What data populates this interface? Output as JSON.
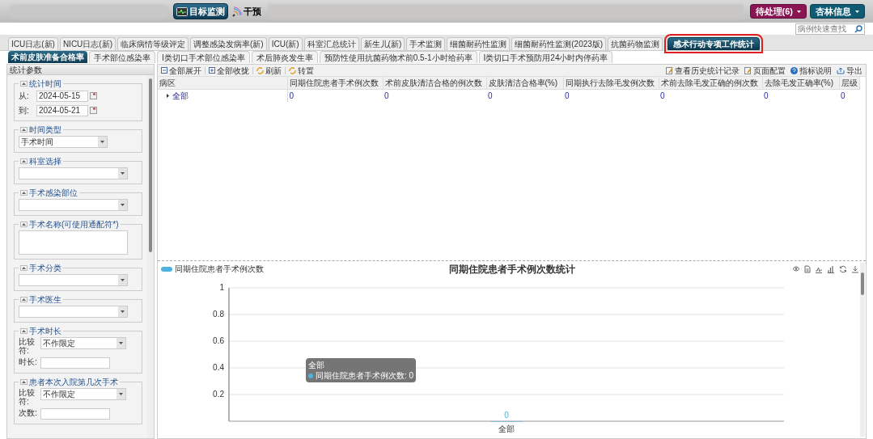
{
  "top_bar": {
    "buttons": [
      {
        "label": "目标监测",
        "kind": "monitor"
      },
      {
        "label": "干预",
        "kind": "intervene"
      }
    ],
    "right_buttons": [
      {
        "label": "待处理(6)",
        "color": "#8a1552"
      },
      {
        "label": "杏林信息",
        "color": "#0f5b74"
      }
    ]
  },
  "search": {
    "placeholder": "病例快速查找"
  },
  "tabs": [
    {
      "label": "ICU日志(新)",
      "selected": false
    },
    {
      "label": "NICU日志(新)",
      "selected": false
    },
    {
      "label": "临床病情等级评定",
      "selected": false
    },
    {
      "label": "调整感染发病率(新)",
      "selected": false
    },
    {
      "label": "ICU(新)",
      "selected": false
    },
    {
      "label": "科室汇总统计",
      "selected": false
    },
    {
      "label": "新生儿(新)",
      "selected": false
    },
    {
      "label": "手术监测",
      "selected": false
    },
    {
      "label": "细菌耐药性监测",
      "selected": false
    },
    {
      "label": "细菌耐药性监测(2023版)",
      "selected": false
    },
    {
      "label": "抗菌药物监测",
      "selected": false
    },
    {
      "label": "感术行动专项工作统计",
      "selected": true
    }
  ],
  "subtabs": [
    {
      "label": "术前皮肤准备合格率",
      "selected": true
    },
    {
      "label": "手术部位感染率",
      "selected": false
    },
    {
      "label": "I类切口手术部位感染率",
      "selected": false
    },
    {
      "label": "术后肺炎发生率",
      "selected": false
    },
    {
      "label": "预防性使用抗菌药物术前0.5-1小时给药率",
      "selected": false
    },
    {
      "label": "I类切口手术预防用24小时内停药率",
      "selected": false
    }
  ],
  "params": {
    "title": "统计参数",
    "groups": [
      {
        "title": "统计时间",
        "kind": "dates",
        "fields": [
          {
            "label": "从:",
            "value": "2024-05-15"
          },
          {
            "label": "到:",
            "value": "2024-05-21"
          }
        ]
      },
      {
        "title": "时间类型",
        "kind": "select",
        "value": "手术时间"
      },
      {
        "title": "科室选择",
        "kind": "select"
      },
      {
        "title": "手术感染部位",
        "kind": "select"
      },
      {
        "title": "手术名称(可使用通配符*)",
        "kind": "textarea"
      },
      {
        "title": "手术分类",
        "kind": "select"
      },
      {
        "title": "手术医生",
        "kind": "select"
      },
      {
        "title": "手术时长",
        "kind": "compare",
        "fields": [
          {
            "label": "比较符:",
            "value": "不作限定"
          },
          {
            "label": "时长:"
          }
        ]
      },
      {
        "title": "患者本次入院第几次手术",
        "kind": "compare",
        "fields": [
          {
            "label": "比较符:",
            "value": "不作限定"
          },
          {
            "label": "次数:"
          }
        ]
      }
    ]
  },
  "toolbar": {
    "left": [
      {
        "label": "全部展开",
        "kind": "expand"
      },
      {
        "label": "全部收拢",
        "kind": "collapse"
      },
      {
        "label": "刷新",
        "kind": "refresh"
      },
      {
        "label": "转置",
        "kind": "pivot"
      }
    ],
    "right": [
      {
        "label": "查看历史统计记录",
        "kind": "history"
      },
      {
        "label": "页面配置",
        "kind": "config"
      },
      {
        "label": "指标说明",
        "kind": "help"
      },
      {
        "label": "导出",
        "kind": "export"
      }
    ]
  },
  "table": {
    "columns": [
      "病区",
      "同期住院患者手术例次数",
      "术前皮肤清洁合格的例次数",
      "皮肤清洁合格率(%)",
      "同期执行去除毛发例次数",
      "术前去除毛发正确的例次数",
      "去除毛发正确率(%)",
      "层级"
    ],
    "rows": [
      {
        "expanded": false,
        "cells": [
          "全部",
          "0",
          "0",
          "0",
          "0",
          "0",
          "0",
          "0"
        ]
      }
    ]
  },
  "chart": {
    "tooltip": {
      "title": "全部",
      "text": "同期住院患者手术例次数: 0"
    },
    "chart_data": {
      "type": "bar",
      "title": "同期住院患者手术例次数统计",
      "categories": [
        "全部"
      ],
      "series": [
        {
          "name": "同期住院患者手术例次数",
          "color": "#4cb3dc",
          "values": [
            0
          ]
        }
      ],
      "ylim": [
        0,
        1
      ],
      "yticks": [
        0.2,
        0.4,
        0.6,
        0.8,
        1
      ],
      "grid": true,
      "data_labels": true
    }
  }
}
